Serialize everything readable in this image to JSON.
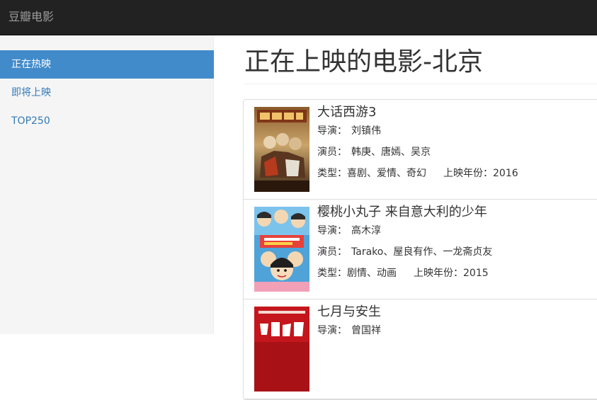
{
  "navbar": {
    "brand": "豆瓣电影"
  },
  "sidebar": {
    "items": [
      {
        "label": "正在热映",
        "active": true
      },
      {
        "label": "即将上映",
        "active": false
      },
      {
        "label": "TOP250",
        "active": false
      }
    ]
  },
  "main": {
    "title": "正在上映的电影-北京",
    "movies": [
      {
        "title": "大话西游3",
        "director_label": "导演：",
        "director": "刘镇伟",
        "actors_label": "演员：",
        "actors": "韩庚、唐嫣、吴京",
        "genre_label": "类型：",
        "genre": "喜剧、爱情、奇幻",
        "year_label": "上映年份：",
        "year": "2016"
      },
      {
        "title": "樱桃小丸子 来自意大利的少年",
        "director_label": "导演：",
        "director": "高木淳",
        "actors_label": "演员：",
        "actors": "Tarako、屋良有作、一龙斋贞友",
        "genre_label": "类型：",
        "genre": "剧情、动画",
        "year_label": "上映年份：",
        "year": "2015"
      },
      {
        "title": "七月与安生",
        "director_label": "导演：",
        "director": "曾国祥"
      }
    ]
  },
  "colors": {
    "navbar_bg": "#222222",
    "brand_text": "#9d9d9d",
    "sidebar_bg": "#f5f5f5",
    "active_bg": "#428bca",
    "link": "#337ab7"
  }
}
